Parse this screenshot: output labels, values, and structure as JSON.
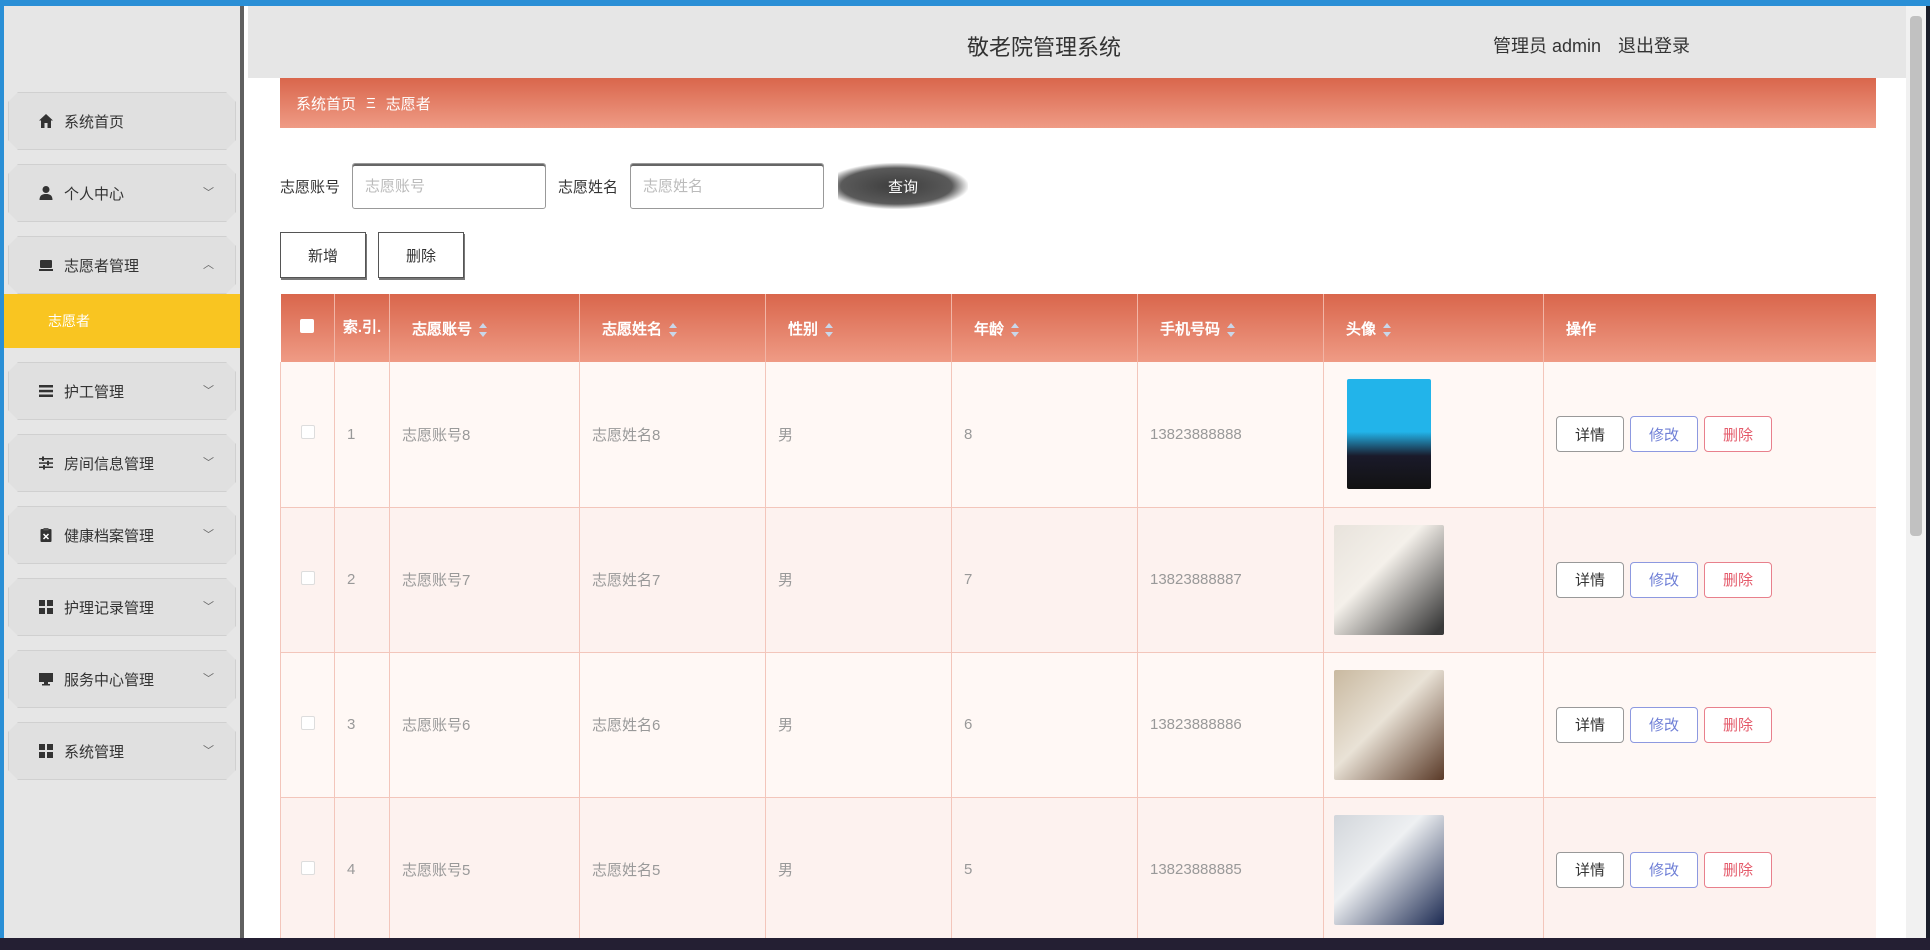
{
  "header": {
    "title": "敬老院管理系统",
    "user": "管理员 admin",
    "logout": "退出登录"
  },
  "sidebar": {
    "items": [
      {
        "label": "系统首页",
        "icon": "home-icon",
        "expandable": false
      },
      {
        "label": "个人中心",
        "icon": "user-icon",
        "expandable": true
      },
      {
        "label": "志愿者管理",
        "icon": "monitor-icon",
        "expandable": true,
        "expanded": true,
        "children": [
          "志愿者"
        ]
      },
      {
        "label": "护工管理",
        "icon": "list-icon",
        "expandable": true
      },
      {
        "label": "房间信息管理",
        "icon": "sliders-icon",
        "expandable": true
      },
      {
        "label": "健康档案管理",
        "icon": "clipboard-icon",
        "expandable": true
      },
      {
        "label": "护理记录管理",
        "icon": "grid-icon",
        "expandable": true
      },
      {
        "label": "服务中心管理",
        "icon": "desktop-icon",
        "expandable": true
      },
      {
        "label": "系统管理",
        "icon": "grid-icon",
        "expandable": true
      }
    ]
  },
  "breadcrumb": {
    "home": "系统首页",
    "separator": "Ξ",
    "current": "志愿者"
  },
  "search": {
    "account_label": "志愿账号",
    "account_placeholder": "志愿账号",
    "name_label": "志愿姓名",
    "name_placeholder": "志愿姓名",
    "query_button": "查询"
  },
  "actions": {
    "add": "新增",
    "delete": "删除"
  },
  "table": {
    "index_header": "索.引.",
    "columns": [
      "志愿账号",
      "志愿姓名",
      "性别",
      "年龄",
      "手机号码",
      "头像",
      "操作"
    ],
    "rows": [
      {
        "index": "1",
        "account": "志愿账号8",
        "name": "志愿姓名8",
        "gender": "男",
        "age": "8",
        "phone": "13823888888"
      },
      {
        "index": "2",
        "account": "志愿账号7",
        "name": "志愿姓名7",
        "gender": "男",
        "age": "7",
        "phone": "13823888887"
      },
      {
        "index": "3",
        "account": "志愿账号6",
        "name": "志愿姓名6",
        "gender": "男",
        "age": "6",
        "phone": "13823888886"
      },
      {
        "index": "4",
        "account": "志愿账号5",
        "name": "志愿姓名5",
        "gender": "男",
        "age": "5",
        "phone": "13823888885"
      }
    ],
    "row_ops": {
      "detail": "详情",
      "edit": "修改",
      "delete": "删除"
    }
  },
  "colors": {
    "accent": "#d9664c",
    "accent_light": "#ef9b85",
    "submenu_active": "#f9c521",
    "edit": "#6f7fd6",
    "delete": "#e45a6a"
  }
}
